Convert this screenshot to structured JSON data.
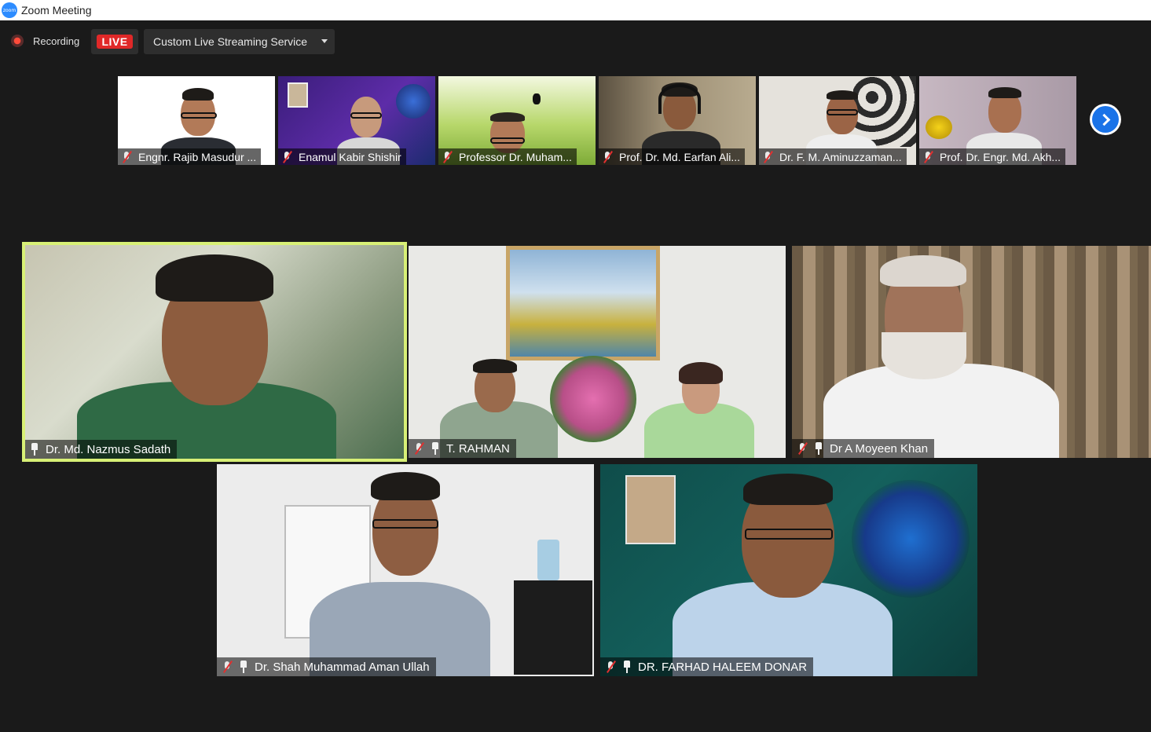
{
  "window": {
    "title": "Zoom Meeting",
    "logo_text": "zoom"
  },
  "toolbar": {
    "recording_label": "Recording",
    "live_label": "LIVE",
    "stream_service_label": "Custom Live Streaming Service"
  },
  "thumbnails": [
    {
      "name": "Engnr. Rajib Masudur ...",
      "muted": true
    },
    {
      "name": "Enamul Kabir Shishir",
      "muted": true
    },
    {
      "name": "Professor Dr. Muham...",
      "muted": true
    },
    {
      "name": "Prof. Dr. Md. Earfan Ali...",
      "muted": true
    },
    {
      "name": "Dr. F. M. Aminuzzaman...",
      "muted": true
    },
    {
      "name": "Prof. Dr. Engr. Md. Akh...",
      "muted": true
    }
  ],
  "gallery": [
    {
      "name": "Dr. Md. Nazmus Sadath",
      "muted": false,
      "pinned": true,
      "active_speaker": true
    },
    {
      "name": "T. RAHMAN",
      "muted": true,
      "pinned": true,
      "active_speaker": false
    },
    {
      "name": "Dr A Moyeen Khan",
      "muted": true,
      "pinned": true,
      "active_speaker": false
    },
    {
      "name": "Dr. Shah Muhammad Aman Ullah",
      "muted": true,
      "pinned": true,
      "active_speaker": false
    },
    {
      "name": "DR. FARHAD HALEEM DONAR",
      "muted": true,
      "pinned": true,
      "active_speaker": false
    }
  ],
  "colors": {
    "background": "#1a1a1a",
    "live_red": "#e02828",
    "active_speaker_border": "#d8f076",
    "next_button": "#1a73e8"
  }
}
